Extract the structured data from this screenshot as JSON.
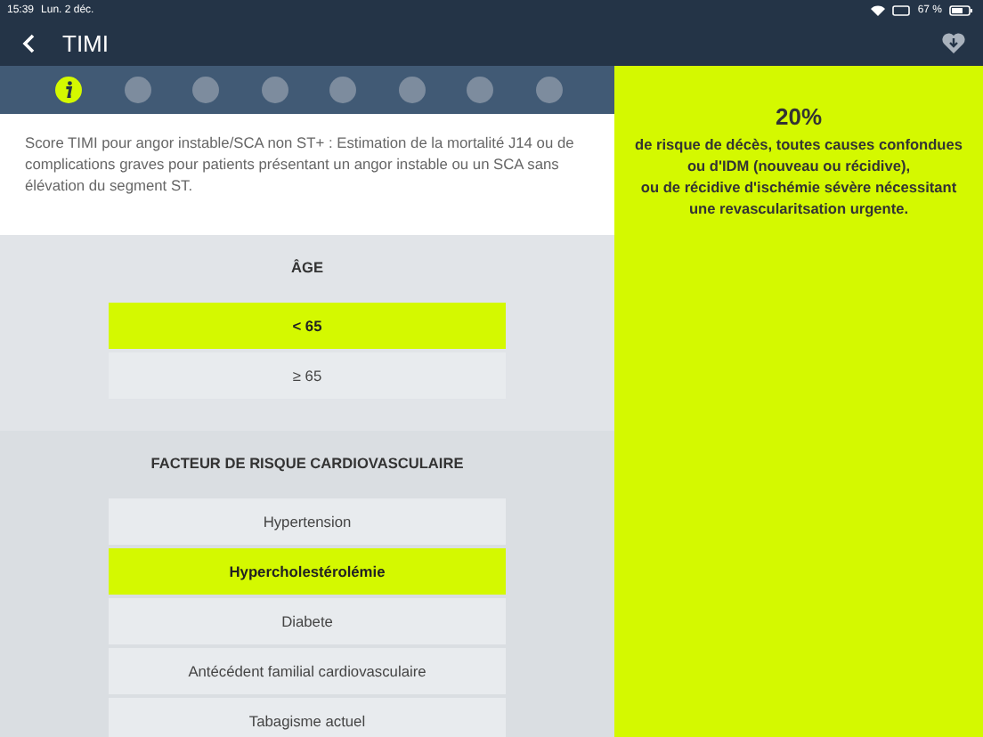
{
  "status_bar": {
    "time": "15:39",
    "date": "Lun. 2 déc.",
    "battery": "67 %"
  },
  "header": {
    "title": "TIMI"
  },
  "steps": [
    {
      "kind": "info",
      "selected": true
    },
    {
      "kind": "step",
      "selected": false
    },
    {
      "kind": "step",
      "selected": false
    },
    {
      "kind": "step",
      "selected": false
    },
    {
      "kind": "step",
      "selected": false
    },
    {
      "kind": "step",
      "selected": false
    },
    {
      "kind": "step",
      "selected": false
    },
    {
      "kind": "step",
      "selected": false
    }
  ],
  "description": "Score TIMI pour angor instable/SCA non ST+ : Estimation de la mortalité J14 ou de complications graves pour patients présentant un angor instable ou un SCA sans élévation du segment ST.",
  "sections": [
    {
      "title": "ÂGE",
      "options": [
        {
          "label": "< 65",
          "selected": true
        },
        {
          "label": "≥ 65",
          "selected": false
        }
      ]
    },
    {
      "title": "FACTEUR DE RISQUE CARDIOVASCULAIRE",
      "options": [
        {
          "label": "Hypertension",
          "selected": false
        },
        {
          "label": "Hypercholestérolémie",
          "selected": true
        },
        {
          "label": "Diabete",
          "selected": false
        },
        {
          "label": "Antécédent familial cardiovasculaire",
          "selected": false
        },
        {
          "label": "Tabagisme actuel",
          "selected": false
        }
      ]
    }
  ],
  "result": {
    "score": "20%",
    "lines": [
      "de risque de décès, toutes causes confondues",
      "ou d'IDM (nouveau ou récidive),",
      "ou de récidive d'ischémie sévère nécessitant",
      "une revascularitsation urgente."
    ]
  }
}
